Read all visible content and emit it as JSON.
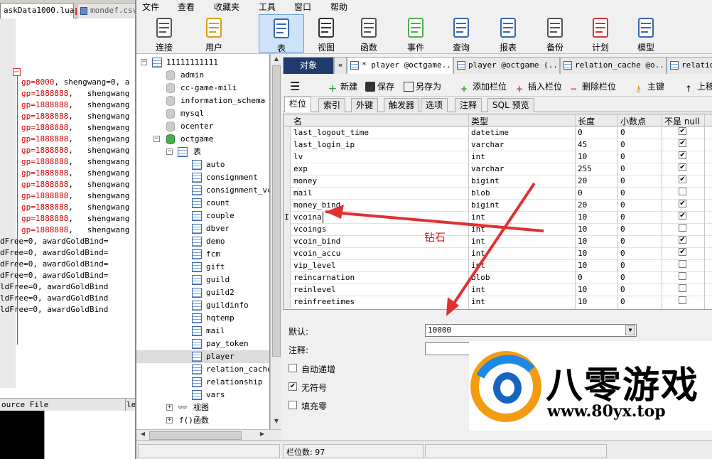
{
  "editor": {
    "tabs": [
      {
        "label": "askData1000.lua",
        "active": true
      },
      {
        "label": "mondef.csv",
        "active": false
      }
    ],
    "lines": [
      {
        "key": "gp=8000",
        "rest": ", shengwang=0, a"
      },
      {
        "key": "gp=1888888",
        "rest": ",   shengwang"
      },
      {
        "key": "gp=1888888",
        "rest": ",   shengwang"
      },
      {
        "key": "gp=1888888",
        "rest": ",   shengwang"
      },
      {
        "key": "gp=1888888",
        "rest": ",   shengwang"
      },
      {
        "key": "gp=1888888",
        "rest": ",   shengwang"
      },
      {
        "key": "gp=1888888",
        "rest": ",   shengwang"
      },
      {
        "key": "gp=1888888",
        "rest": ",   shengwang"
      },
      {
        "key": "gp=1888888",
        "rest": ",   shengwang"
      },
      {
        "key": "gp=1888888",
        "rest": ",   shengwang"
      },
      {
        "key": "gp=1888888",
        "rest": ",   shengwang"
      },
      {
        "key": "gp=1888888",
        "rest": ",   shengwang"
      },
      {
        "key": "gp=1888888",
        "rest": ",   shengwang"
      },
      {
        "key": "gp=1888888",
        "rest": ",   shengwang"
      },
      {
        "key": "",
        "rest": "dFree=0, awardGoldBind="
      },
      {
        "key": "",
        "rest": "dFree=0, awardGoldBind="
      },
      {
        "key": "",
        "rest": "dFree=0, awardGoldBind="
      },
      {
        "key": "",
        "rest": "dFree=0, awardGoldBind="
      },
      {
        "key": "",
        "rest": "ldFree=0, awardGoldBind"
      },
      {
        "key": "",
        "rest": "ldFree=0, awardGoldBind"
      },
      {
        "key": "",
        "rest": "ldFree=0, awardGoldBind"
      }
    ],
    "status_left": "ource File",
    "status_right": "le"
  },
  "menu": [
    "文件",
    "查看",
    "收藏夹",
    "工具",
    "窗口",
    "帮助"
  ],
  "toolbar": [
    {
      "label": "连接",
      "icon": "plug-icon"
    },
    {
      "label": "用户",
      "icon": "user-icon"
    },
    {
      "label": "表",
      "icon": "table-icon",
      "active": true
    },
    {
      "label": "视图",
      "icon": "glasses-icon"
    },
    {
      "label": "函数",
      "icon": "function-icon"
    },
    {
      "label": "事件",
      "icon": "event-icon"
    },
    {
      "label": "查询",
      "icon": "query-icon"
    },
    {
      "label": "报表",
      "icon": "report-icon"
    },
    {
      "label": "备份",
      "icon": "backup-icon"
    },
    {
      "label": "计划",
      "icon": "calendar-icon"
    },
    {
      "label": "模型",
      "icon": "model-icon"
    }
  ],
  "tree": {
    "connection": "11111111111",
    "databases": [
      "admin",
      "cc-game-mili",
      "information_schema",
      "mysql",
      "ocenter"
    ],
    "open_db": "octgame",
    "tables_folder": "表",
    "tables": [
      "auto",
      "consignment",
      "consignment_vc",
      "count",
      "couple",
      "dbver",
      "demo",
      "fcm",
      "gift",
      "guild",
      "guild2",
      "guildinfo",
      "hqtemp",
      "mail",
      "pay_token",
      "player",
      "relation_cache",
      "relationship",
      "vars"
    ],
    "selected_table": "player",
    "views_folder": "视图",
    "functions_folder": "函数"
  },
  "doc_tabs": {
    "object": "对象",
    "tabs": [
      "* player @octgame...",
      "player @octgame (...",
      "relation_cache @o...",
      "relation"
    ]
  },
  "object_toolbar": {
    "new": "新建",
    "save": "保存",
    "save_as": "另存为",
    "add_field": "添加栏位",
    "insert_field": "插入栏位",
    "delete_field": "删除栏位",
    "primary_key": "主键",
    "move_up": "上移"
  },
  "sub_tabs": [
    "栏位",
    "索引",
    "外键",
    "触发器",
    "选项",
    "注释",
    "SQL 预览"
  ],
  "grid": {
    "headers": [
      "名",
      "类型",
      "长度",
      "小数点",
      "不是 null"
    ],
    "rows": [
      {
        "name": "last_logout_time",
        "type": "datetime",
        "len": "0",
        "dec": "0",
        "notnull": true
      },
      {
        "name": "last_login_ip",
        "type": "varchar",
        "len": "45",
        "dec": "0",
        "notnull": true
      },
      {
        "name": "lv",
        "type": "int",
        "len": "10",
        "dec": "0",
        "notnull": true
      },
      {
        "name": "exp",
        "type": "varchar",
        "len": "255",
        "dec": "0",
        "notnull": true
      },
      {
        "name": "money",
        "type": "bigint",
        "len": "20",
        "dec": "0",
        "notnull": true
      },
      {
        "name": "mail",
        "type": "blob",
        "len": "0",
        "dec": "0",
        "notnull": false
      },
      {
        "name": "money_bind",
        "type": "bigint",
        "len": "20",
        "dec": "0",
        "notnull": true
      },
      {
        "name": "vcoina",
        "type": "int",
        "len": "10",
        "dec": "0",
        "notnull": true,
        "editing": true
      },
      {
        "name": "vcoings",
        "type": "int",
        "len": "10",
        "dec": "0",
        "notnull": false
      },
      {
        "name": "vcoin_bind",
        "type": "int",
        "len": "10",
        "dec": "0",
        "notnull": true
      },
      {
        "name": "vcoin_accu",
        "type": "int",
        "len": "10",
        "dec": "0",
        "notnull": true
      },
      {
        "name": "vip_level",
        "type": "int",
        "len": "10",
        "dec": "0",
        "notnull": false
      },
      {
        "name": "reincarnation",
        "type": "blob",
        "len": "0",
        "dec": "0",
        "notnull": false
      },
      {
        "name": "reinlevel",
        "type": "int",
        "len": "10",
        "dec": "0",
        "notnull": false
      },
      {
        "name": "reinfreetimes",
        "type": "int",
        "len": "10",
        "dec": "0",
        "notnull": false
      }
    ]
  },
  "props": {
    "default_label": "默认:",
    "default_value": "10000",
    "comment_label": "注释:",
    "comment_value": "",
    "auto_inc": "自动递增",
    "auto_inc_checked": false,
    "unsigned": "无符号",
    "unsigned_checked": true,
    "zerofill": "填充零",
    "zerofill_checked": false
  },
  "status": {
    "field_count": "栏位数: 97"
  },
  "annotation": {
    "text": "钻石",
    "color": "#d02020"
  },
  "watermark": {
    "cn": "八零游戏",
    "url": "www.80yx.top"
  },
  "colors": {
    "object_tab": "#1f3b6e",
    "selected_tool": "#cde3f7",
    "arrow": "#e03030"
  }
}
